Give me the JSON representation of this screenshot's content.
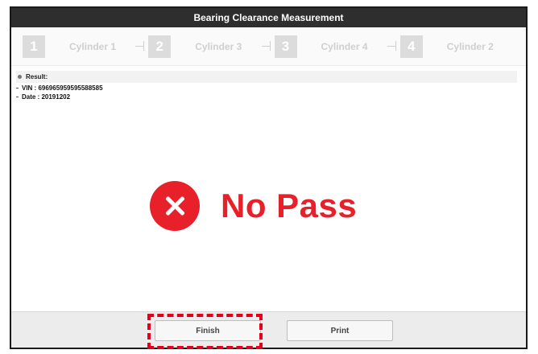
{
  "window": {
    "title": "Bearing Clearance Measurement"
  },
  "steps": [
    {
      "number": "1",
      "label": "Cylinder 1"
    },
    {
      "number": "2",
      "label": "Cylinder 3"
    },
    {
      "number": "3",
      "label": "Cylinder 4"
    },
    {
      "number": "4",
      "label": "Cylinder 2"
    }
  ],
  "result": {
    "heading": "Result:",
    "vin": "VIN : 696965959595588585",
    "date": "Date : 20191202"
  },
  "verdict": {
    "text": "No Pass",
    "icon": "x-circle-icon",
    "color": "#e8202a"
  },
  "footer": {
    "finish_label": "Finish",
    "print_label": "Print"
  },
  "annotation": {
    "highlight_color": "#e2001a"
  }
}
